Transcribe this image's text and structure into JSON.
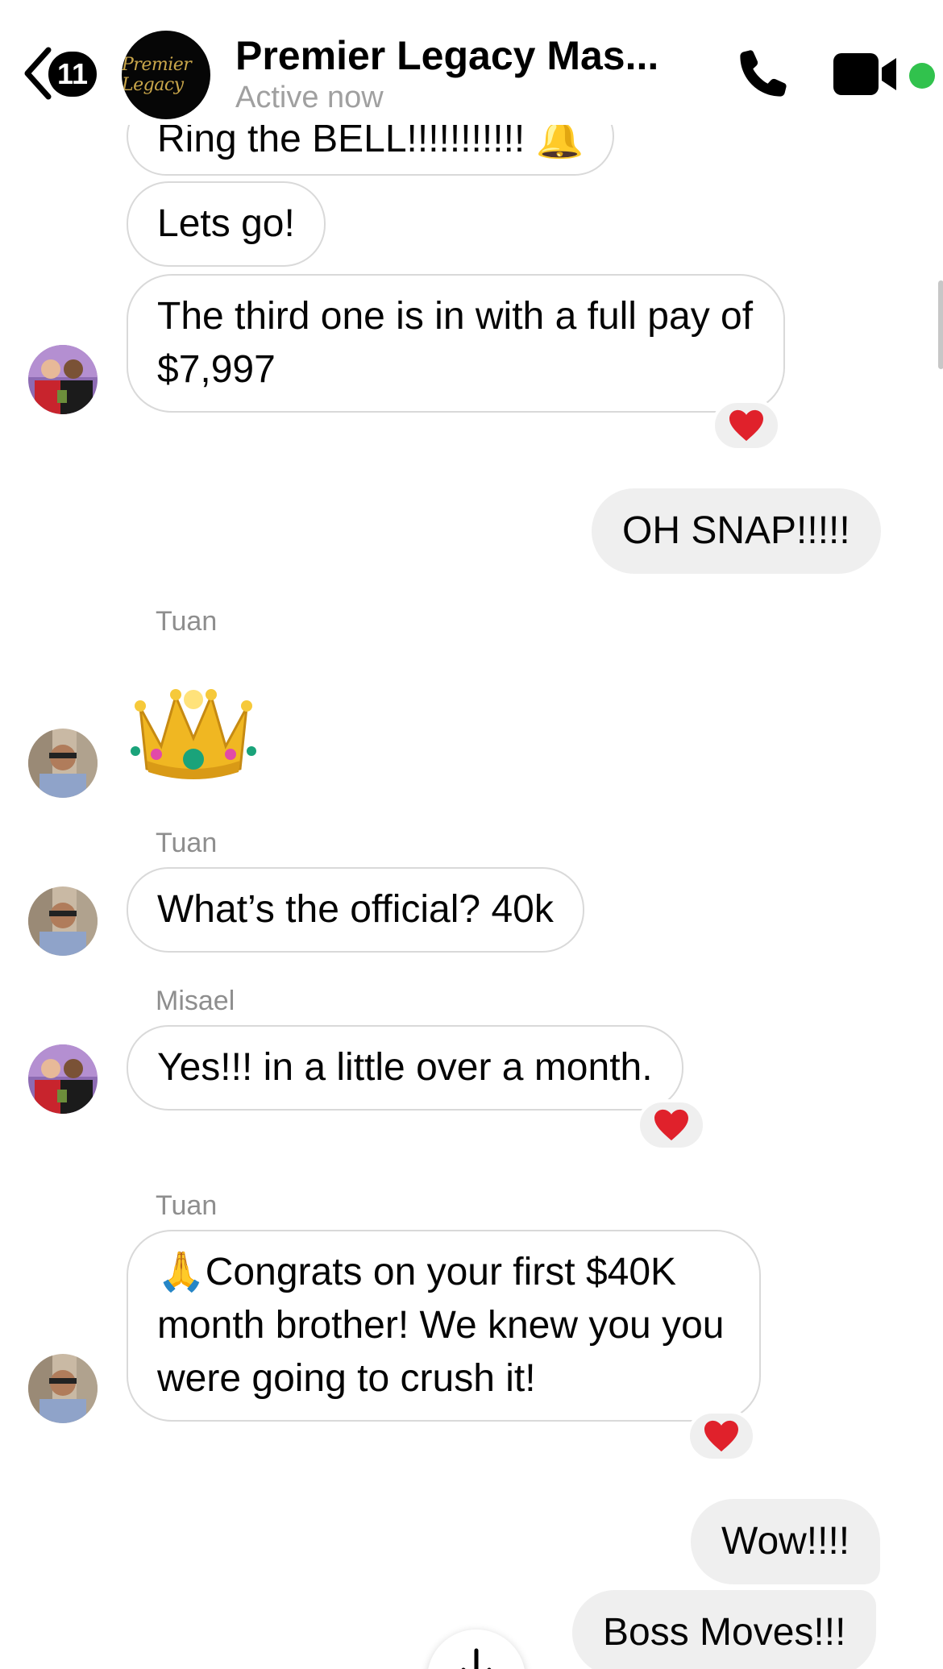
{
  "header": {
    "unread_count": "11",
    "chat_title": "Premier Legacy Mas...",
    "status": "Active now",
    "group_logo_text": "Premier Legacy"
  },
  "messages": [
    {
      "text": "Ring the BELL!!!!!!!!!!! 🔔"
    },
    {
      "text": "Lets go!"
    },
    {
      "text": "The third one is in with a full pay of $7,997",
      "reaction": "❤️"
    },
    {
      "text": "OH SNAP!!!!!"
    },
    {
      "sender": "Tuan",
      "emoji": "👑"
    },
    {
      "sender": "Tuan",
      "text": "What’s the official? 40k"
    },
    {
      "sender": "Misael",
      "text": "Yes!!! in a little over a month.",
      "reaction": "❤️"
    },
    {
      "sender": "Tuan",
      "text": "🙏Congrats on your first $40K month brother! We knew you you were going to crush it!",
      "reaction": "❤️"
    },
    {
      "text": "Wow!!!!"
    },
    {
      "text": "Boss Moves!!!"
    }
  ],
  "colors": {
    "incoming_border": "#d9d9d9",
    "outgoing_bg": "#efefef",
    "online": "#31c24d",
    "heart": "#e0212b"
  }
}
